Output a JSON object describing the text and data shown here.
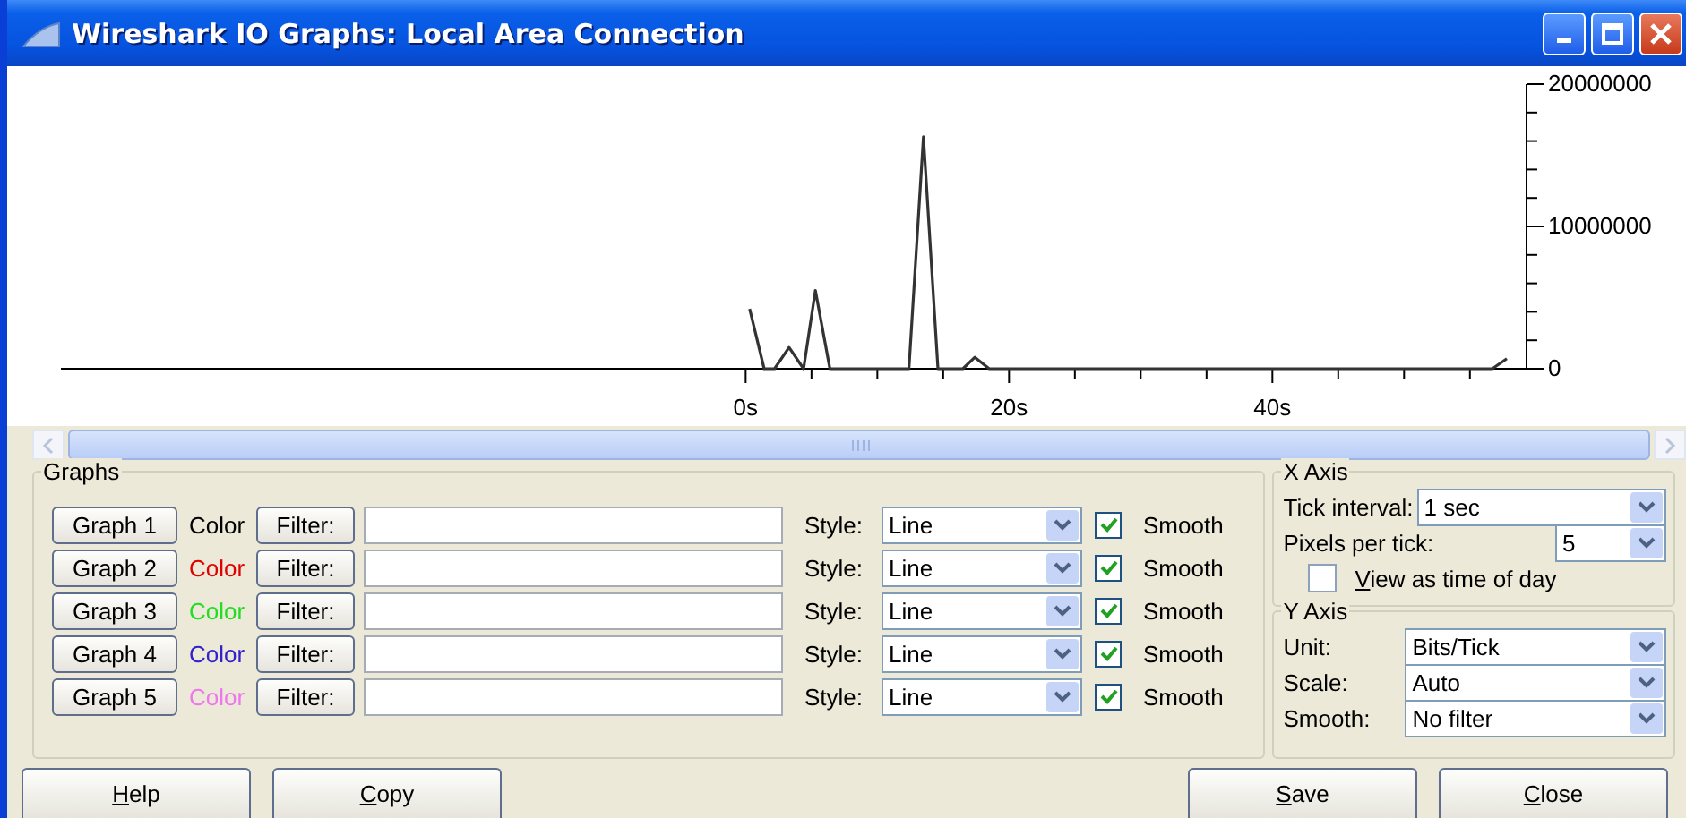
{
  "window": {
    "title": "Wireshark IO Graphs: Local Area Connection"
  },
  "chart_data": {
    "type": "line",
    "x": [
      0.3,
      1.4,
      2.2,
      3.3,
      4.4,
      5.3,
      6.4,
      12.4,
      13.5,
      14.6,
      16.5,
      17.4,
      18.5,
      56.7,
      57.8
    ],
    "series": [
      {
        "color": "#333333",
        "values": [
          4200000,
          0,
          0,
          1500000,
          0,
          5500000,
          0,
          0,
          16300000,
          0,
          0,
          800000,
          0,
          0,
          700000
        ]
      }
    ],
    "xlim": [
      -52,
      59.3
    ],
    "ylim": [
      0,
      20000000
    ],
    "xticks": [
      {
        "value": 0,
        "label": "0s"
      },
      {
        "value": 20,
        "label": "20s"
      },
      {
        "value": 40,
        "label": "40s"
      }
    ],
    "yticks": [
      {
        "value": 0,
        "label": "0"
      },
      {
        "value": 10000000,
        "label": "10000000"
      },
      {
        "value": 20000000,
        "label": "20000000"
      }
    ]
  },
  "graphs": {
    "title": "Graphs",
    "rows": [
      {
        "button": "Graph 1",
        "color_label": "Color",
        "color": "#000000",
        "filter_button": "Filter:",
        "style_label": "Style:",
        "style": "Line",
        "smooth_label": "Smooth",
        "smooth": true
      },
      {
        "button": "Graph 2",
        "color_label": "Color",
        "color": "#e00000",
        "filter_button": "Filter:",
        "style_label": "Style:",
        "style": "Line",
        "smooth_label": "Smooth",
        "smooth": true
      },
      {
        "button": "Graph 3",
        "color_label": "Color",
        "color": "#22dd22",
        "filter_button": "Filter:",
        "style_label": "Style:",
        "style": "Line",
        "smooth_label": "Smooth",
        "smooth": true
      },
      {
        "button": "Graph 4",
        "color_label": "Color",
        "color": "#3322cc",
        "filter_button": "Filter:",
        "style_label": "Style:",
        "style": "Line",
        "smooth_label": "Smooth",
        "smooth": true
      },
      {
        "button": "Graph 5",
        "color_label": "Color",
        "color": "#ee77ee",
        "filter_button": "Filter:",
        "style_label": "Style:",
        "style": "Line",
        "smooth_label": "Smooth",
        "smooth": true
      }
    ]
  },
  "x_axis": {
    "title": "X Axis",
    "tick_interval_label": "Tick interval:",
    "tick_interval": "1 sec",
    "pixels_per_tick_label": "Pixels per tick:",
    "pixels_per_tick": "5",
    "view_as_time_of_day": {
      "label": "View as time of day",
      "checked": false
    }
  },
  "y_axis": {
    "title": "Y Axis",
    "unit_label": "Unit:",
    "unit": "Bits/Tick",
    "scale_label": "Scale:",
    "scale": "Auto",
    "smooth_label": "Smooth:",
    "smooth": "No filter"
  },
  "buttons": [
    "Help",
    "Copy",
    "Save",
    "Close"
  ]
}
